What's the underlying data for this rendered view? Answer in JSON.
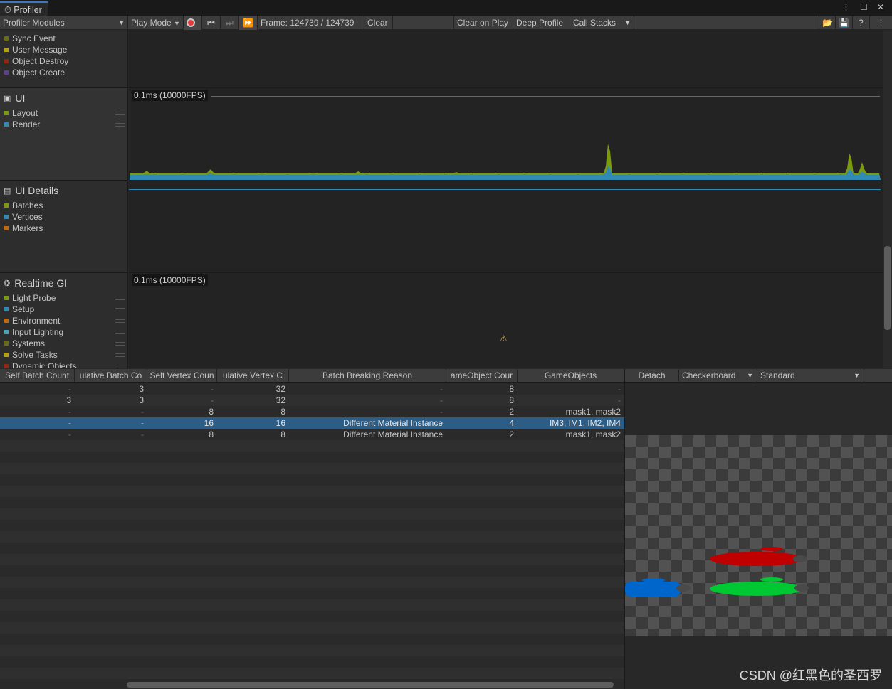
{
  "window": {
    "tab_title": "Profiler",
    "controls": "⋮ ☐ ✕"
  },
  "toolbar": {
    "modules_dropdown": "Profiler Modules",
    "play_mode": "Play Mode",
    "frame": "Frame: 124739 / 124739",
    "clear": "Clear",
    "clear_on_play": "Clear on Play",
    "deep_profile": "Deep Profile",
    "call_stacks": "Call Stacks"
  },
  "modules": {
    "top": {
      "counters": [
        {
          "label": "Sync Event",
          "color": "#6b6b14"
        },
        {
          "label": "User Message",
          "color": "#b5a00f"
        },
        {
          "label": "Object Destroy",
          "color": "#8c2a10"
        },
        {
          "label": "Object Create",
          "color": "#5e3f8c"
        }
      ]
    },
    "ui": {
      "title": "UI",
      "counters": [
        {
          "label": "Layout",
          "color": "#7c9a10"
        },
        {
          "label": "Render",
          "color": "#2f8bb3"
        }
      ],
      "chart_label": "0.1ms (10000FPS)"
    },
    "ui_details": {
      "title": "UI Details",
      "counters": [
        {
          "label": "Batches",
          "color": "#7c9a10"
        },
        {
          "label": "Vertices",
          "color": "#2f8bb3"
        },
        {
          "label": "Markers",
          "color": "#c06a10"
        }
      ]
    },
    "realtime_gi": {
      "title": "Realtime GI",
      "counters": [
        {
          "label": "Light Probe",
          "color": "#7c9a10"
        },
        {
          "label": "Setup",
          "color": "#2f8bb3"
        },
        {
          "label": "Environment",
          "color": "#c06a10"
        },
        {
          "label": "Input Lighting",
          "color": "#4aa3b5"
        },
        {
          "label": "Systems",
          "color": "#6b6b14"
        },
        {
          "label": "Solve Tasks",
          "color": "#b5a00f"
        },
        {
          "label": "Dynamic Objects",
          "color": "#8c2a10"
        }
      ],
      "chart_label": "0.1ms (10000FPS)"
    }
  },
  "table": {
    "columns": [
      "Self Batch Count",
      "Cumulative Batch Count",
      "Self Vertex Count",
      "Cumulative Vertex Count",
      "Batch Breaking Reason",
      "GameObject Count",
      "GameObjects"
    ],
    "column_visible": [
      "Self Batch Count",
      "ulative Batch Co",
      "Self Vertex Coun",
      "ulative Vertex C",
      "Batch Breaking Reason",
      "ameObject Cour",
      "GameObjects"
    ],
    "rows": [
      [
        "-",
        "3",
        "-",
        "32",
        "-",
        "8",
        "-"
      ],
      [
        "3",
        "3",
        "-",
        "32",
        "-",
        "8",
        "-"
      ],
      [
        "-",
        "-",
        "8",
        "8",
        "-",
        "2",
        "mask1, mask2"
      ],
      [
        "-",
        "-",
        "16",
        "16",
        "Different Material Instance",
        "4",
        "IM3, IM1, IM2, IM4"
      ],
      [
        "-",
        "-",
        "8",
        "8",
        "Different Material Instance",
        "2",
        "mask1, mask2"
      ]
    ],
    "selected_row": 3
  },
  "preview": {
    "detach": "Detach",
    "background": "Checkerboard",
    "mode": "Standard",
    "shapes": [
      {
        "color": "#c00000"
      },
      {
        "color": "#0066cc"
      },
      {
        "color": "#00c832"
      }
    ]
  },
  "watermark": "CSDN @红黑色的圣西罗"
}
